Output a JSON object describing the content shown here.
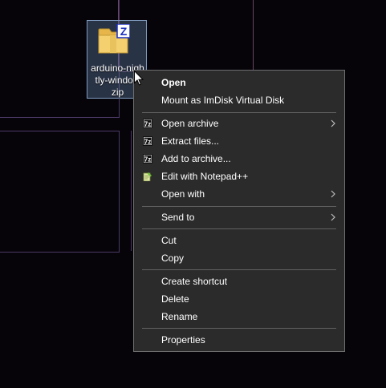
{
  "desktop_icon": {
    "label": "arduino-nigh\ntly-window\nzip",
    "badge_letter": "Z"
  },
  "menu": {
    "open": "Open",
    "mount_imdisk": "Mount as ImDisk Virtual Disk",
    "open_archive": "Open archive",
    "extract_files": "Extract files...",
    "add_to_archive": "Add to archive...",
    "edit_notepadpp": "Edit with Notepad++",
    "open_with": "Open with",
    "send_to": "Send to",
    "cut": "Cut",
    "copy": "Copy",
    "create_shortcut": "Create shortcut",
    "delete": "Delete",
    "rename": "Rename",
    "properties": "Properties",
    "sevenzip_icon_text": "7z"
  },
  "colors": {
    "menu_bg": "#2b2b2b",
    "menu_border": "#6e6e6e",
    "separator": "#626262",
    "selection": "#6482aa",
    "frame_accent": "#5a3f6a"
  },
  "icons": {
    "file": "zip-folder-icon",
    "sevenzip": "7zip-icon",
    "notepadpp": "notepadpp-icon",
    "submenu": "chevron-right-icon",
    "cursor": "mouse-cursor-icon"
  }
}
